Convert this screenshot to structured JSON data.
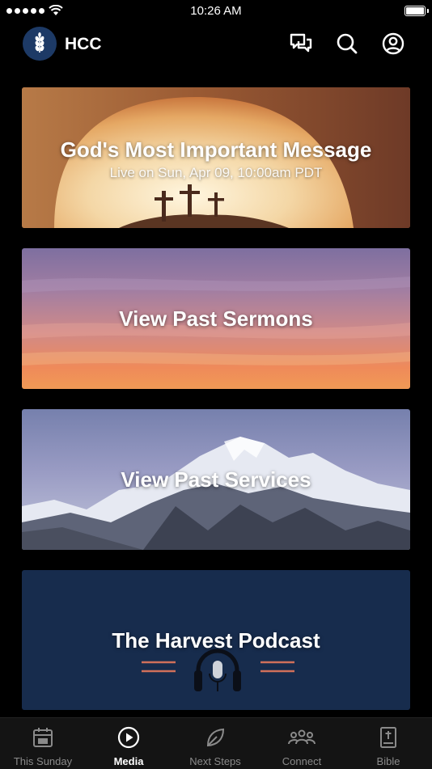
{
  "status_bar": {
    "time": "10:26 AM"
  },
  "header": {
    "title": "HCC",
    "icons": [
      "chat-bubbles-icon",
      "search-icon",
      "account-icon"
    ]
  },
  "cards": [
    {
      "title": "God's Most Important Message",
      "subtitle": "Live on Sun, Apr 09, 10:00am PDT"
    },
    {
      "title": "View Past Sermons"
    },
    {
      "title": "View Past Services"
    },
    {
      "title": "The Harvest Podcast"
    }
  ],
  "tabs": [
    {
      "label": "This Sunday",
      "icon": "calendar-icon",
      "active": false
    },
    {
      "label": "Media",
      "icon": "play-circle-icon",
      "active": true
    },
    {
      "label": "Next Steps",
      "icon": "leaf-icon",
      "active": false
    },
    {
      "label": "Connect",
      "icon": "people-icon",
      "active": false
    },
    {
      "label": "Bible",
      "icon": "bible-icon",
      "active": false
    }
  ],
  "colors": {
    "background": "#000000",
    "podcast_card": "#172c4d",
    "logo_bg": "#1d3a66",
    "tab_inactive": "#8a8a8a",
    "tab_active": "#ffffff",
    "podcast_accent": "#d0705a"
  }
}
